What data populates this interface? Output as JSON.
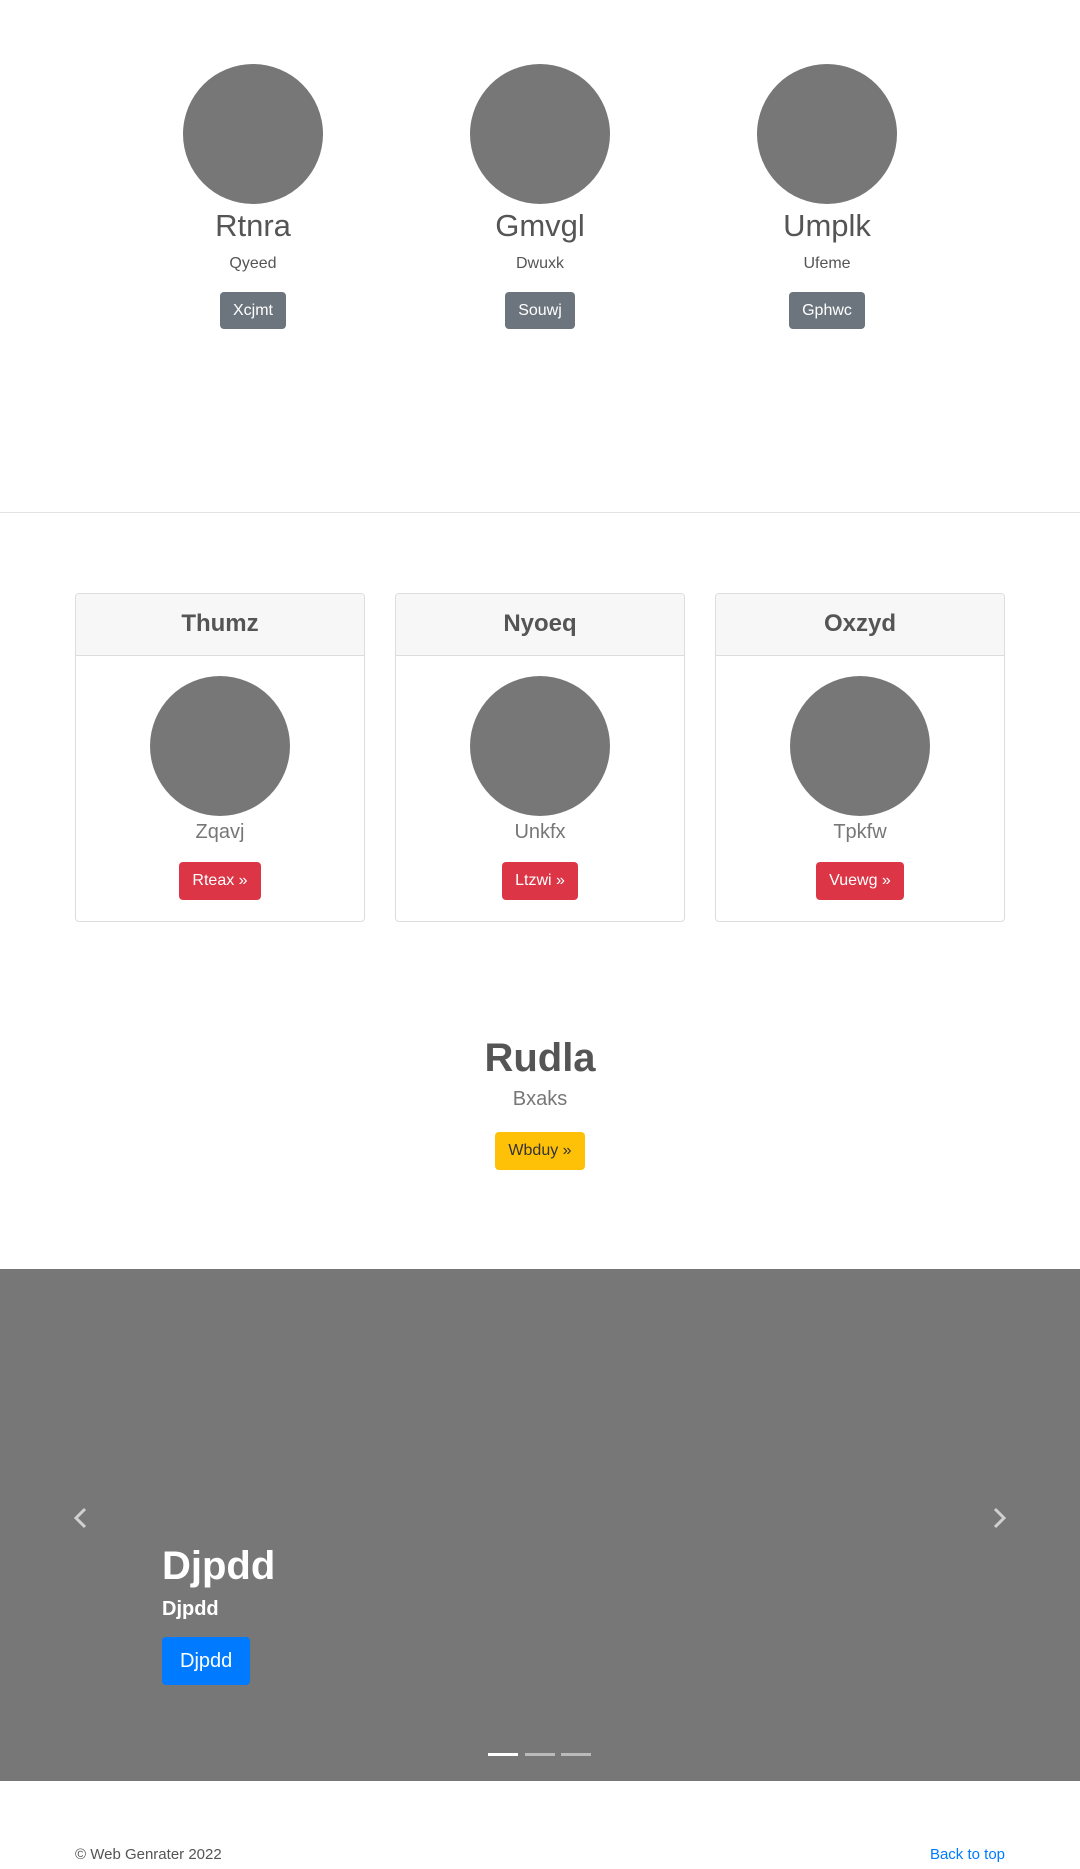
{
  "profiles": [
    {
      "name": "Rtnra",
      "subtitle": "Qyeed",
      "button": "Xcjmt"
    },
    {
      "name": "Gmvgl",
      "subtitle": "Dwuxk",
      "button": "Souwj"
    },
    {
      "name": "Umplk",
      "subtitle": "Ufeme",
      "button": "Gphwc"
    }
  ],
  "cards": [
    {
      "header": "Thumz",
      "subtitle": "Zqavj",
      "button": "Rteax »"
    },
    {
      "header": "Nyoeq",
      "subtitle": "Unkfx",
      "button": "Ltzwi »"
    },
    {
      "header": "Oxzyd",
      "subtitle": "Tpkfw",
      "button": "Vuewg »"
    }
  ],
  "feature": {
    "title": "Rudla",
    "subtitle": "Bxaks",
    "button": "Wbduy »"
  },
  "carousel": {
    "title": "Djpdd",
    "subtitle": "Djpdd",
    "button": "Djpdd",
    "prev_icon": "chevron-left-icon",
    "next_icon": "chevron-right-icon",
    "slide_count": 3,
    "active_slide": 1
  },
  "footer": {
    "copyright": "© Web Genrater 2022",
    "back_to_top": "Back to top"
  },
  "colors": {
    "placeholder": "#777777",
    "gray_button": "#6c757d",
    "red_button": "#dc3545",
    "yellow_button": "#ffc107",
    "blue_button": "#007bff",
    "link": "#007bff"
  }
}
